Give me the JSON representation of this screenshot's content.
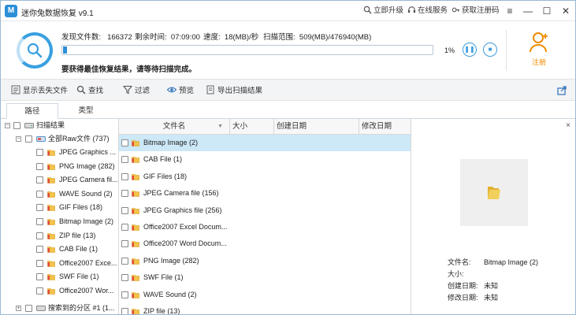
{
  "window": {
    "title": "迷你兔数据恢复 v9.1"
  },
  "titlebar": {
    "upgrade": "立即升级",
    "service": "在线服务",
    "get_code": "获取注册码"
  },
  "scan": {
    "found_label": "发现文件数:",
    "found_value": "166372",
    "remain_label": "剩余时间:",
    "remain_value": "07:09:00",
    "speed_label": "速度:",
    "speed_value": "18(MB)/秒",
    "range_label": "扫描范围:",
    "range_value": "509(MB)/476940(MB)",
    "progress_percent": 1,
    "percent_text": "1%",
    "message": "要获得最佳恢复结果，请等待扫描完成。",
    "register_label": "注册"
  },
  "toolbar": {
    "show_lost": "显示丢失文件",
    "find": "查找",
    "filter": "过滤",
    "preview": "预览",
    "export": "导出扫描结果"
  },
  "tabs": [
    "路径",
    "类型"
  ],
  "tree": {
    "root": "扫描结果",
    "raw": "全部Raw文件 (737)",
    "children": [
      "JPEG Graphics ...",
      "PNG Image (282)",
      "JPEG Camera fil...",
      "WAVE Sound (2)",
      "GIF Files (18)",
      "Bitmap Image (2)",
      "ZIP file (13)",
      "CAB File (1)",
      "Office2007 Exce...",
      "SWF File (1)",
      "Office2007 Wor..."
    ],
    "partition": "搜索到的分区 #1 (1..."
  },
  "list": {
    "headers": [
      "文件名",
      "大小",
      "创建日期",
      "修改日期"
    ],
    "rows": [
      "Bitmap Image (2)",
      "CAB File (1)",
      "GIF Files (18)",
      "JPEG Camera file (156)",
      "JPEG Graphics file (256)",
      "Office2007 Excel Docum...",
      "Office2007 Word Docum...",
      "PNG Image (282)",
      "SWF File (1)",
      "WAVE Sound (2)",
      "ZIP file (13)"
    ]
  },
  "preview": {
    "close": "×",
    "filename_label": "文件名:",
    "filename_value": "Bitmap Image (2)",
    "size_label": "大小:",
    "size_value": "",
    "created_label": "创建日期:",
    "created_value": "未知",
    "modified_label": "修改日期:",
    "modified_value": "未知"
  },
  "colors": {
    "accent": "#2c8fd8",
    "register": "#f08c00",
    "selected_row": "#cde8f7"
  }
}
